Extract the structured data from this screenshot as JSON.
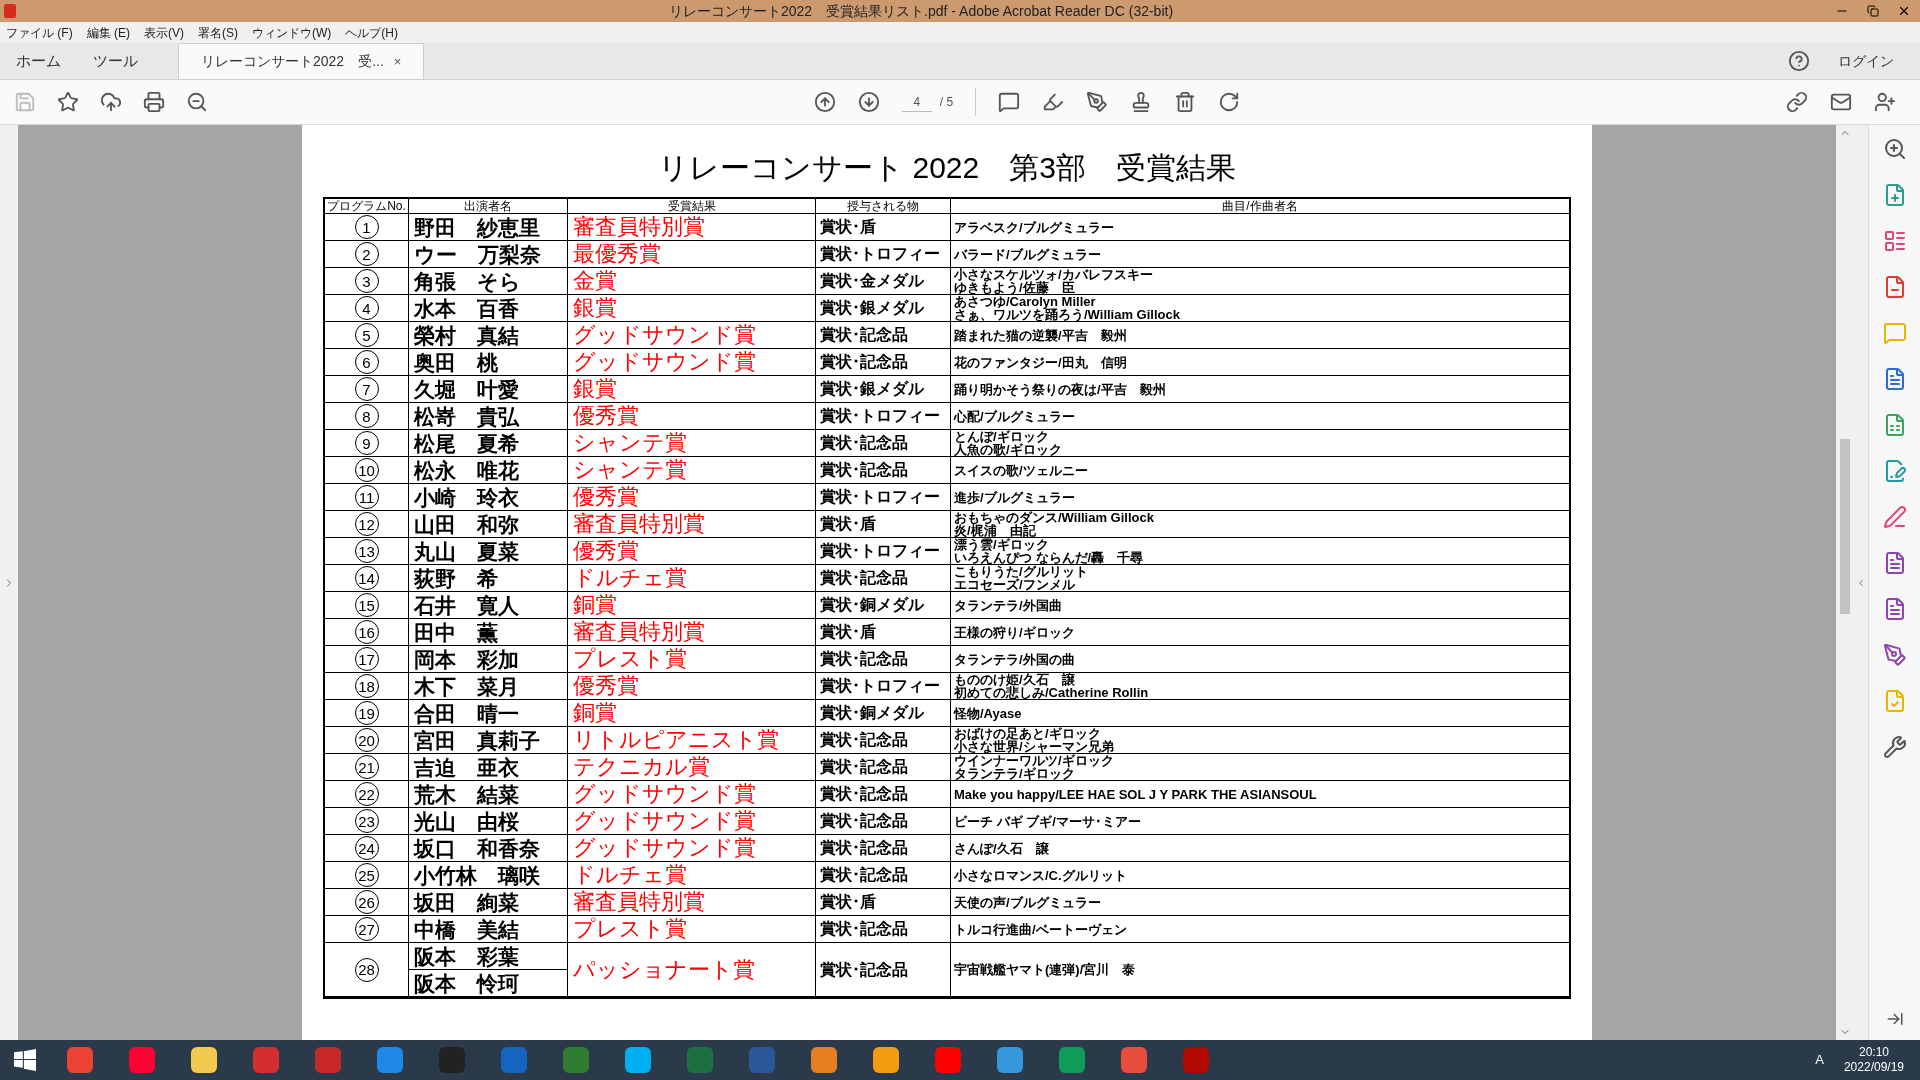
{
  "window": {
    "title": "リレーコンサート2022　受賞結果リスト.pdf - Adobe Acrobat Reader DC (32-bit)"
  },
  "menu": [
    "ファイル (F)",
    "編集 (E)",
    "表示(V)",
    "署名(S)",
    "ウィンドウ(W)",
    "ヘルプ(H)"
  ],
  "tabs": [
    {
      "label": "ホーム",
      "selected": false,
      "kind": "nav"
    },
    {
      "label": "ツール",
      "selected": false,
      "kind": "nav"
    },
    {
      "label": "リレーコンサート2022　受...",
      "selected": true,
      "kind": "document",
      "close": "×"
    }
  ],
  "login": "ログイン",
  "toolbar": {
    "page": "4",
    "page_total": "/ 5"
  },
  "document": {
    "title": "リレーコンサート 2022　第3部　受賞結果",
    "columns": [
      "プログラムNo.",
      "出演者名",
      "受賞結果",
      "授与される物",
      "曲目/作曲者名"
    ],
    "rows": [
      {
        "no": "1",
        "names": [
          "野田　紗恵里"
        ],
        "award": "審査員特別賞",
        "item": "賞状･盾",
        "songs": [
          "アラベスク/ブルグミュラー"
        ]
      },
      {
        "no": "2",
        "names": [
          "ウー　万梨奈"
        ],
        "award": "最優秀賞",
        "item": "賞状･トロフィー",
        "songs": [
          "バラード/ブルグミュラー"
        ]
      },
      {
        "no": "3",
        "names": [
          "角張　そら"
        ],
        "award": "金賞",
        "item": "賞状･金メダル",
        "songs": [
          "小さなスケルツォ/カバレフスキー",
          "ゆきもよう/佐藤　臣"
        ]
      },
      {
        "no": "4",
        "names": [
          "水本　百香"
        ],
        "award": "銀賞",
        "item": "賞状･銀メダル",
        "songs": [
          "あさつゆ/Carolyn Miller",
          "さぁ、ワルツを踊ろう/William Gillock"
        ]
      },
      {
        "no": "5",
        "names": [
          "榮村　真結"
        ],
        "award": "グッドサウンド賞",
        "item": "賞状･記念品",
        "songs": [
          "踏まれた猫の逆襲/平吉　毅州"
        ]
      },
      {
        "no": "6",
        "names": [
          "奥田　桃"
        ],
        "award": "グッドサウンド賞",
        "item": "賞状･記念品",
        "songs": [
          "花のファンタジー/田丸　信明"
        ]
      },
      {
        "no": "7",
        "names": [
          "久堀　叶愛"
        ],
        "award": "銀賞",
        "item": "賞状･銀メダル",
        "songs": [
          "踊り明かそう祭りの夜は/平吉　毅州"
        ]
      },
      {
        "no": "8",
        "names": [
          "松嵜　貴弘"
        ],
        "award": "優秀賞",
        "item": "賞状･トロフィー",
        "songs": [
          "心配/ブルグミュラー"
        ]
      },
      {
        "no": "9",
        "names": [
          "松尾　夏希"
        ],
        "award": "シャンテ賞",
        "item": "賞状･記念品",
        "songs": [
          "とんぼ/ギロック",
          "人魚の歌/ギロック"
        ]
      },
      {
        "no": "10",
        "names": [
          "松永　唯花"
        ],
        "award": "シャンテ賞",
        "item": "賞状･記念品",
        "songs": [
          "スイスの歌/ツェルニー"
        ]
      },
      {
        "no": "11",
        "names": [
          "小崎　玲衣"
        ],
        "award": "優秀賞",
        "item": "賞状･トロフィー",
        "songs": [
          "進歩/ブルグミュラー"
        ]
      },
      {
        "no": "12",
        "names": [
          "山田　和弥"
        ],
        "award": "審査員特別賞",
        "item": "賞状･盾",
        "songs": [
          "おもちゃのダンス/William Gillock",
          "炎/梶浦　由記"
        ]
      },
      {
        "no": "13",
        "names": [
          "丸山　夏菜"
        ],
        "award": "優秀賞",
        "item": "賞状･トロフィー",
        "songs": [
          "漂う雲/ギロック",
          "いろえんぴつ ならんだ/轟　千尋"
        ]
      },
      {
        "no": "14",
        "names": [
          "荻野　希"
        ],
        "award": "ドルチェ賞",
        "item": "賞状･記念品",
        "songs": [
          "こもりうた/グルリット",
          "エコセーズ/フンメル"
        ]
      },
      {
        "no": "15",
        "names": [
          "石井　寛人"
        ],
        "award": "銅賞",
        "item": "賞状･銅メダル",
        "songs": [
          "タランテラ/外国曲"
        ]
      },
      {
        "no": "16",
        "names": [
          "田中　薫"
        ],
        "award": "審査員特別賞",
        "item": "賞状･盾",
        "songs": [
          "王様の狩り/ギロック"
        ]
      },
      {
        "no": "17",
        "names": [
          "岡本　彩加"
        ],
        "award": "プレスト賞",
        "item": "賞状･記念品",
        "songs": [
          "タランテラ/外国の曲"
        ]
      },
      {
        "no": "18",
        "names": [
          "木下　菜月"
        ],
        "award": "優秀賞",
        "item": "賞状･トロフィー",
        "songs": [
          "もののけ姫/久石　譲",
          "初めての悲しみ/Catherine Rollin"
        ]
      },
      {
        "no": "19",
        "names": [
          "合田　晴一"
        ],
        "award": "銅賞",
        "item": "賞状･銅メダル",
        "songs": [
          "怪物/Ayase"
        ]
      },
      {
        "no": "20",
        "names": [
          "宮田　真莉子"
        ],
        "award": "リトルピアニスト賞",
        "item": "賞状･記念品",
        "songs": [
          "おばけの足あと/ギロック",
          "小さな世界/シャーマン兄弟"
        ]
      },
      {
        "no": "21",
        "names": [
          "吉迫　亜衣"
        ],
        "award": "テクニカル賞",
        "item": "賞状･記念品",
        "songs": [
          "ウインナーワルツ/ギロック",
          "タランテラ/ギロック"
        ]
      },
      {
        "no": "22",
        "names": [
          "荒木　結菜"
        ],
        "award": "グッドサウンド賞",
        "item": "賞状･記念品",
        "songs": [
          "Make you happy/LEE HAE SOL J Y PARK THE ASIANSOUL"
        ]
      },
      {
        "no": "23",
        "names": [
          "光山　由桜"
        ],
        "award": "グッドサウンド賞",
        "item": "賞状･記念品",
        "songs": [
          "ビーチ バギ ブギ/マーサ･ミアー"
        ]
      },
      {
        "no": "24",
        "names": [
          "坂口　和香奈"
        ],
        "award": "グッドサウンド賞",
        "item": "賞状･記念品",
        "songs": [
          "さんぽ/久石　譲"
        ]
      },
      {
        "no": "25",
        "names": [
          "小竹林　璃咲"
        ],
        "award": "ドルチェ賞",
        "item": "賞状･記念品",
        "songs": [
          "小さなロマンス/C.グルリット"
        ]
      },
      {
        "no": "26",
        "names": [
          "坂田　絢菜"
        ],
        "award": "審査員特別賞",
        "item": "賞状･盾",
        "songs": [
          "天使の声/ブルグミュラー"
        ]
      },
      {
        "no": "27",
        "names": [
          "中橋　美結"
        ],
        "award": "プレスト賞",
        "item": "賞状･記念品",
        "songs": [
          "トルコ行進曲/ベートーヴェン"
        ]
      },
      {
        "no": "28",
        "names": [
          "阪本　彩葉",
          "阪本　怜珂"
        ],
        "award": "パッショナート賞",
        "item": "賞状･記念品",
        "songs": [
          "宇宙戦艦ヤマト(連弾)/宮川　泰"
        ]
      }
    ]
  },
  "taskbar": {
    "time": "20:10",
    "date": "2022/09/19",
    "ime": "A"
  }
}
